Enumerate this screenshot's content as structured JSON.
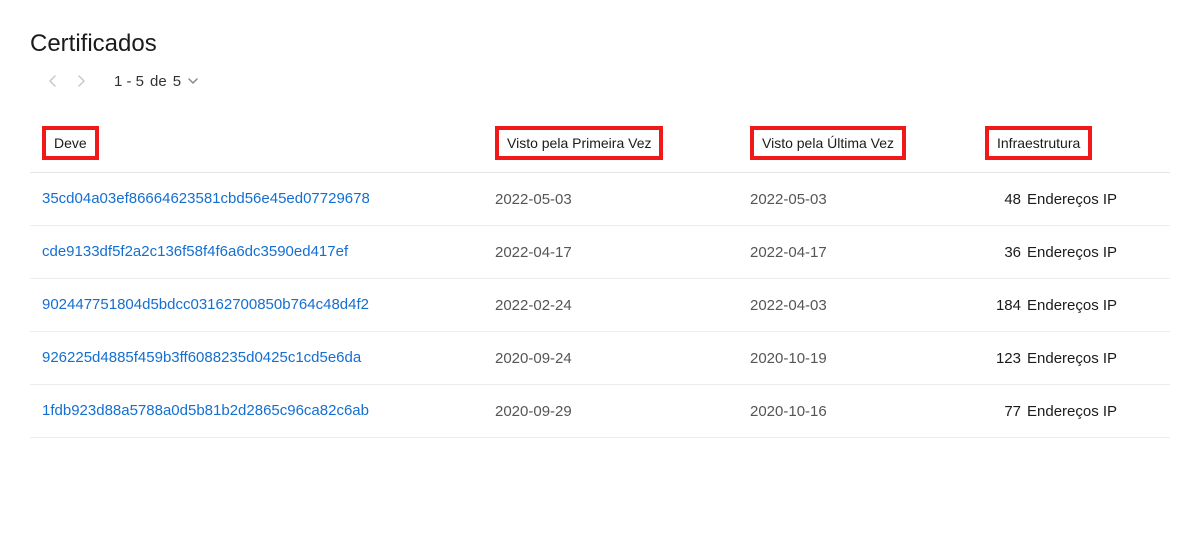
{
  "title": "Certificados",
  "pagination": {
    "range": "1 - 5",
    "of_word": "de",
    "total": "5"
  },
  "headers": {
    "hash": "Deve",
    "first_seen": "Visto pela Primeira Vez",
    "last_seen": "Visto pela Última Vez",
    "infra": "Infraestrutura"
  },
  "infra_unit": "Endereços IP",
  "rows": [
    {
      "hash": "35cd04a03ef86664623581cbd56e45ed07729678",
      "first_seen": "2022-05-03",
      "last_seen": "2022-05-03",
      "infra_count": "48"
    },
    {
      "hash": "cde9133df5f2a2c136f58f4f6a6dc3590ed417ef",
      "first_seen": "2022-04-17",
      "last_seen": "2022-04-17",
      "infra_count": "36"
    },
    {
      "hash": "902447751804d5bdcc03162700850b764c48d4f2",
      "first_seen": "2022-02-24",
      "last_seen": "2022-04-03",
      "infra_count": "184"
    },
    {
      "hash": "926225d4885f459b3ff6088235d0425c1cd5e6da",
      "first_seen": "2020-09-24",
      "last_seen": "2020-10-19",
      "infra_count": "123"
    },
    {
      "hash": "1fdb923d88a5788a0d5b81b2d2865c96ca82c6ab",
      "first_seen": "2020-09-29",
      "last_seen": "2020-10-16",
      "infra_count": "77"
    }
  ]
}
